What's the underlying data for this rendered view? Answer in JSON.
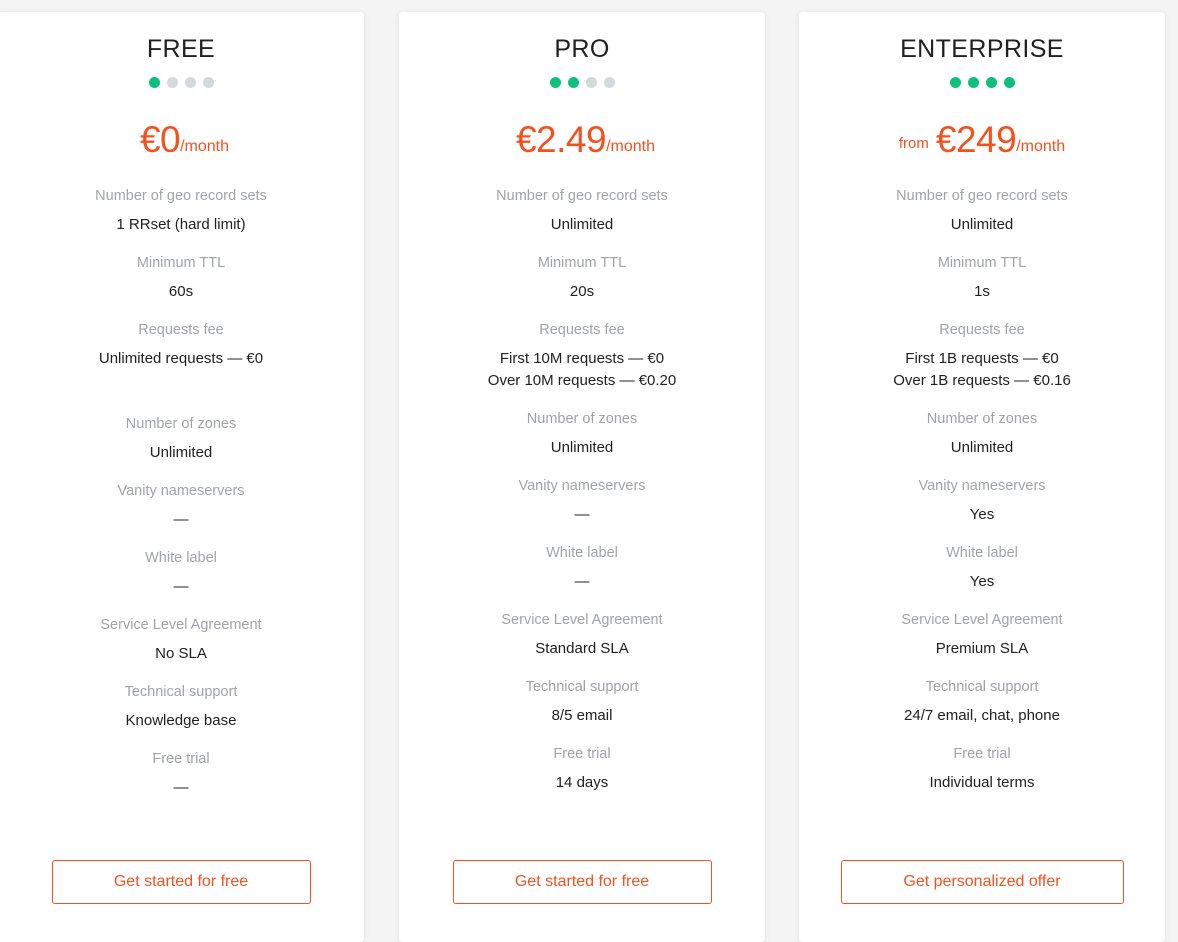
{
  "page": {
    "background_color": "#f4f4f5",
    "accent_color": "#f4511e",
    "level_color": "#0fbf7f",
    "label_color": "#a0a4a8",
    "value_color": "#212121"
  },
  "feature_labels": {
    "geo_record_sets": "Number of geo record sets",
    "minimum_ttl": "Minimum TTL",
    "requests_fee": "Requests fee",
    "zones": "Number of zones",
    "vanity_nameservers": "Vanity nameservers",
    "white_label": "White label",
    "sla": "Service Level Agreement",
    "technical_support": "Technical support",
    "free_trial": "Free trial"
  },
  "plans": [
    {
      "name": "FREE",
      "level": 1,
      "level_max": 4,
      "price_from": "",
      "price_amount": "€0",
      "price_period": "/month",
      "features": {
        "geo_record_sets": "1 RRset (hard limit)",
        "minimum_ttl": "60s",
        "requests_fee": "Unlimited requests — €0",
        "zones": "Unlimited",
        "vanity_nameservers": "—",
        "white_label": "—",
        "sla": "No SLA",
        "technical_support": "Knowledge base",
        "free_trial": "—"
      },
      "cta_label": "Get started for free"
    },
    {
      "name": "PRO",
      "level": 2,
      "level_max": 4,
      "price_from": "",
      "price_amount": "€2.49",
      "price_period": "/month",
      "features": {
        "geo_record_sets": "Unlimited",
        "minimum_ttl": "20s",
        "requests_fee": "First 10M requests — €0\nOver 10M requests — €0.20",
        "zones": "Unlimited",
        "vanity_nameservers": "—",
        "white_label": "—",
        "sla": "Standard SLA",
        "technical_support": "8/5 email",
        "free_trial": "14 days"
      },
      "cta_label": "Get started for free"
    },
    {
      "name": "ENTERPRISE",
      "level": 4,
      "level_max": 4,
      "price_from": "from",
      "price_amount": "€249",
      "price_period": "/month",
      "features": {
        "geo_record_sets": "Unlimited",
        "minimum_ttl": "1s",
        "requests_fee": "First 1B requests — €0\nOver 1B requests — €0.16",
        "zones": "Unlimited",
        "vanity_nameservers": "Yes",
        "white_label": "Yes",
        "sla": "Premium SLA",
        "technical_support": "24/7 email, chat, phone",
        "free_trial": "Individual terms"
      },
      "cta_label": "Get personalized offer"
    }
  ]
}
